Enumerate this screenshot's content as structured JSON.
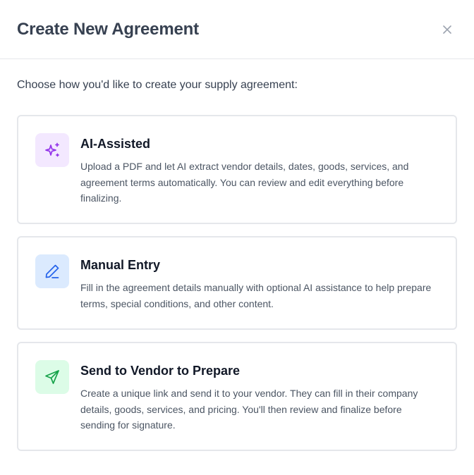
{
  "dialog": {
    "title": "Create New Agreement",
    "close_icon": "close-icon",
    "intro": "Choose how you'd like to create your supply agreement:"
  },
  "options": [
    {
      "title": "AI-Assisted",
      "description": "Upload a PDF and let AI extract vendor details, dates, goods, services, and agreement terms automatically. You can review and edit everything before finalizing.",
      "icon": "sparkles-icon",
      "icon_color": "#9333ea",
      "icon_bg": "#f3e8ff"
    },
    {
      "title": "Manual Entry",
      "description": "Fill in the agreement details manually with optional AI assistance to help prepare terms, special conditions, and other content.",
      "icon": "pencil-icon",
      "icon_color": "#2563eb",
      "icon_bg": "#dbeafe"
    },
    {
      "title": "Send to Vendor to Prepare",
      "description": "Create a unique link and send it to your vendor. They can fill in their company details, goods, services, and pricing. You'll then review and finalize before sending for signature.",
      "icon": "send-icon",
      "icon_color": "#16a34a",
      "icon_bg": "#dcfce7"
    }
  ]
}
